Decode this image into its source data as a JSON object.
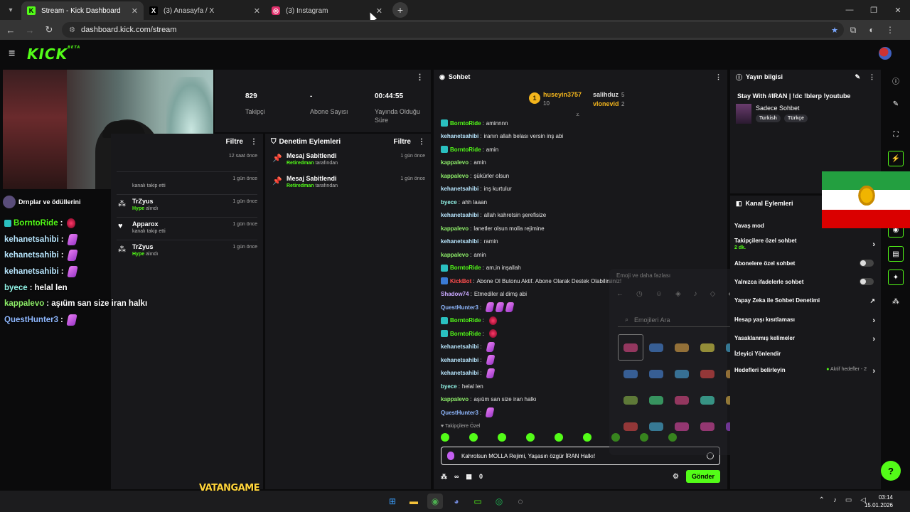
{
  "browser": {
    "tabs": [
      {
        "title": "Stream - Kick Dashboard",
        "icon": "kick-favicon",
        "color": "#53fc18",
        "active": true
      },
      {
        "title": "(3) Anasayfa / X",
        "icon": "x-favicon",
        "color": "#ffffff",
        "active": false
      },
      {
        "title": "(3) Instagram",
        "icon": "instagram-favicon",
        "color": "#e1306c",
        "active": false
      }
    ],
    "url": "dashboard.kick.com/stream"
  },
  "kick": {
    "logo": "KICK",
    "logo_badge": "BETA"
  },
  "stats": [
    {
      "value": "829",
      "label": "Takipçi"
    },
    {
      "value": "-",
      "label": "Abone Sayısı"
    },
    {
      "value": "00:44:55",
      "label": "Yayında Olduğu Süre"
    }
  ],
  "activity": {
    "filter_label": "Filtre",
    "items": [
      {
        "name": "",
        "sub": "",
        "time": "12 saat önce",
        "icon": "heart-icon"
      },
      {
        "name": "",
        "sub": "kanalı takip etti",
        "time": "1 gün önce",
        "icon": "heart-icon"
      },
      {
        "name": "TrZyus",
        "sub_green": "Hype",
        "sub": "alındı",
        "time": "1 gün önce",
        "icon": "hype-icon"
      },
      {
        "name": "Apparox",
        "sub": "kanalı takip etti",
        "time": "1 gün önce",
        "icon": "heart-icon"
      },
      {
        "name": "TrZyus",
        "sub_green": "Hype",
        "sub": "alındı",
        "time": "1 gün önce",
        "icon": "hype-icon"
      }
    ]
  },
  "moderation": {
    "title": "Denetim Eylemleri",
    "filter_label": "Filtre",
    "items": [
      {
        "name": "Mesaj Sabitlendi",
        "actor": "Retiredman",
        "suffix": "tarafından",
        "time": "1 gün önce"
      },
      {
        "name": "Mesaj Sabitlendi",
        "actor": "Retiredman",
        "suffix": "tarafından",
        "time": "1 gün önce"
      }
    ]
  },
  "overlay_chat": {
    "top_text": "Drnplar ve ödüllerini",
    "lines": [
      {
        "user": "BorntoRide",
        "text": ":",
        "color": "#53fc18",
        "emote": "red",
        "badge": true
      },
      {
        "user": "kehanetsahibi",
        "text": ":",
        "color": "#b9e7ff",
        "emote": "purple"
      },
      {
        "user": "kehanetsahibi",
        "text": ":",
        "color": "#b9e7ff",
        "emote": "purple"
      },
      {
        "user": "kehanetsahibi",
        "text": ":",
        "color": "#b9e7ff",
        "emote": "purple"
      },
      {
        "user": "byece",
        "text": ": helal len",
        "color": "#93f5e8",
        "emote": ""
      },
      {
        "user": "kappalevo",
        "text": ": aşıüm san size iran halkı",
        "color": "#8ff06a",
        "emote": ""
      },
      {
        "user": "QuestHunter3",
        "text": ":",
        "color": "#8fb8ff",
        "emote": "purple"
      }
    ]
  },
  "chat": {
    "title": "Sohbet",
    "leaderboard": {
      "rank": "1",
      "first": {
        "name": "huseyin3757",
        "count": "10"
      },
      "second": {
        "name": "salihduz",
        "count": "5"
      },
      "third": {
        "name": "vlonevid",
        "count": "2"
      }
    },
    "messages": [
      {
        "user": "BorntoRide",
        "text": "aminnnn",
        "color": "#53fc18",
        "badge": true
      },
      {
        "user": "kehanetsahibi",
        "text": "iranın allah belası versin inş abi",
        "color": "#b9e7ff"
      },
      {
        "user": "BorntoRide",
        "text": "amin",
        "color": "#53fc18",
        "badge": true
      },
      {
        "user": "kappalevo",
        "text": "amin",
        "color": "#8ff06a"
      },
      {
        "user": "kappalevo",
        "text": "şükürler olsun",
        "color": "#8ff06a"
      },
      {
        "user": "kehanetsahibi",
        "text": "inş kurtulur",
        "color": "#b9e7ff"
      },
      {
        "user": "byece",
        "text": "ahh laaan",
        "color": "#93f5e8"
      },
      {
        "user": "kehanetsahibi",
        "text": "allah kahretsin şerefisize",
        "color": "#b9e7ff"
      },
      {
        "user": "kappalevo",
        "text": "lanetler olsun molla rejimine",
        "color": "#8ff06a"
      },
      {
        "user": "kehanetsahibi",
        "text": "ramin",
        "color": "#b9e7ff"
      },
      {
        "user": "kappalevo",
        "text": "amin",
        "color": "#8ff06a"
      },
      {
        "user": "BorntoRide",
        "text": "am,in inşallah",
        "color": "#53fc18",
        "badge": true
      },
      {
        "user": "KickBot",
        "text": "Abone Ol Butonu Aktif. Abone Olarak Destek Olabilirsiniz!",
        "color": "#ff4d4d",
        "badge": true
      },
      {
        "user": "Shadow74",
        "text": "Etmediler al dimş abi",
        "color": "#c9a8ff"
      },
      {
        "user": "QuestHunter3",
        "text": "",
        "color": "#8fb8ff",
        "emote": "purple3"
      },
      {
        "user": "BorntoRide",
        "text": "",
        "color": "#53fc18",
        "badge": true,
        "emote": "red"
      },
      {
        "user": "BorntoRide",
        "text": "",
        "color": "#53fc18",
        "badge": true,
        "emote": "red"
      },
      {
        "user": "kehanetsahibi",
        "text": "",
        "color": "#b9e7ff",
        "emote": "purple"
      },
      {
        "user": "kehanetsahibi",
        "text": "",
        "color": "#b9e7ff",
        "emote": "purple"
      },
      {
        "user": "kehanetsahibi",
        "text": "",
        "color": "#b9e7ff",
        "emote": "purple"
      },
      {
        "user": "byece",
        "text": "helal len",
        "color": "#93f5e8"
      },
      {
        "user": "kappalevo",
        "text": "aşıüm san size iran halkı",
        "color": "#8ff06a"
      },
      {
        "user": "QuestHunter3",
        "text": "",
        "color": "#8fb8ff",
        "emote": "purple"
      }
    ],
    "follow_only_label": "Takipçilere Özel",
    "input_value": "Kahrolsun MOLLA Rejimi, Yaşasın özgür İRAN Halkı!",
    "footer_infinity": "∞",
    "footer_count": "0",
    "send_label": "Gönder"
  },
  "emoji_picker": {
    "title": "Emoji ve daha fazlası",
    "search_placeholder": "Emojileri Ara"
  },
  "stream_info": {
    "title": "Yayın bilgisi",
    "stream_title": "Stay With #IRAN | !dc !blerp !youtube",
    "category": "Sadece Sohbet",
    "tags": [
      "Turkish",
      "Türkçe"
    ]
  },
  "channel_actions": {
    "title": "Kanal Eylemleri",
    "rows": [
      {
        "label": "Yavaş mod",
        "sub": "",
        "control": "none"
      },
      {
        "label": "Takipçilere özel sohbet",
        "sub": "2 dk.",
        "control": "chevron"
      },
      {
        "label": "Abonelere özel sohbet",
        "sub": "",
        "control": "toggle"
      },
      {
        "label": "Yalnızca ifadelerle sohbet",
        "sub": "",
        "control": "toggle"
      },
      {
        "label": "Yapay Zeka ile Sohbet Denetimi",
        "sub": "",
        "control": "external"
      },
      {
        "label": "Hesap yaşı kısıtlaması",
        "sub": "",
        "control": "chevron"
      },
      {
        "label": "Yasaklanmış kelimeler",
        "sub": "",
        "control": "chevron"
      },
      {
        "label": "İzleyici Yönlendir",
        "sub": "",
        "control": "none"
      },
      {
        "label": "Hedefleri belirleyin",
        "sub": "",
        "control": "chevron",
        "aktif": "Aktif hedefler - 2"
      }
    ]
  },
  "watermark": "VATANGAME",
  "taskbar": {
    "time": "03:14",
    "date": "15.01.2026"
  }
}
